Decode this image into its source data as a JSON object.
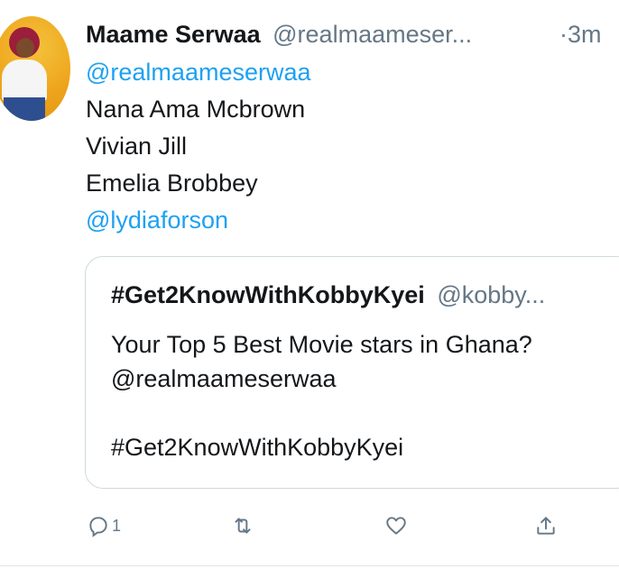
{
  "tweet": {
    "author_name": "Maame Serwaa",
    "author_handle": "@realmaameser...",
    "time": "·3m",
    "lines": [
      {
        "text": "@realmaameserwaa",
        "mention": true
      },
      {
        "text": "Nana Ama Mcbrown",
        "mention": false
      },
      {
        "text": "Vivian Jill",
        "mention": false
      },
      {
        "text": "Emelia Brobbey",
        "mention": false
      },
      {
        "text": "@lydiaforson",
        "mention": true
      }
    ]
  },
  "quote": {
    "title": "#Get2KnowWithKobbyKyei",
    "handle": "@kobby...",
    "line1": "Your Top 5 Best Movie stars in Ghana?",
    "line2": "@realmaameserwaa",
    "line3": "#Get2KnowWithKobbyKyei"
  },
  "actions": {
    "reply_count": "1",
    "icons": [
      "reply-icon",
      "retweet-icon",
      "like-icon",
      "share-icon"
    ]
  },
  "colors": {
    "accent": "#1da1f2",
    "muted": "#657786",
    "border": "#cfd9de"
  }
}
